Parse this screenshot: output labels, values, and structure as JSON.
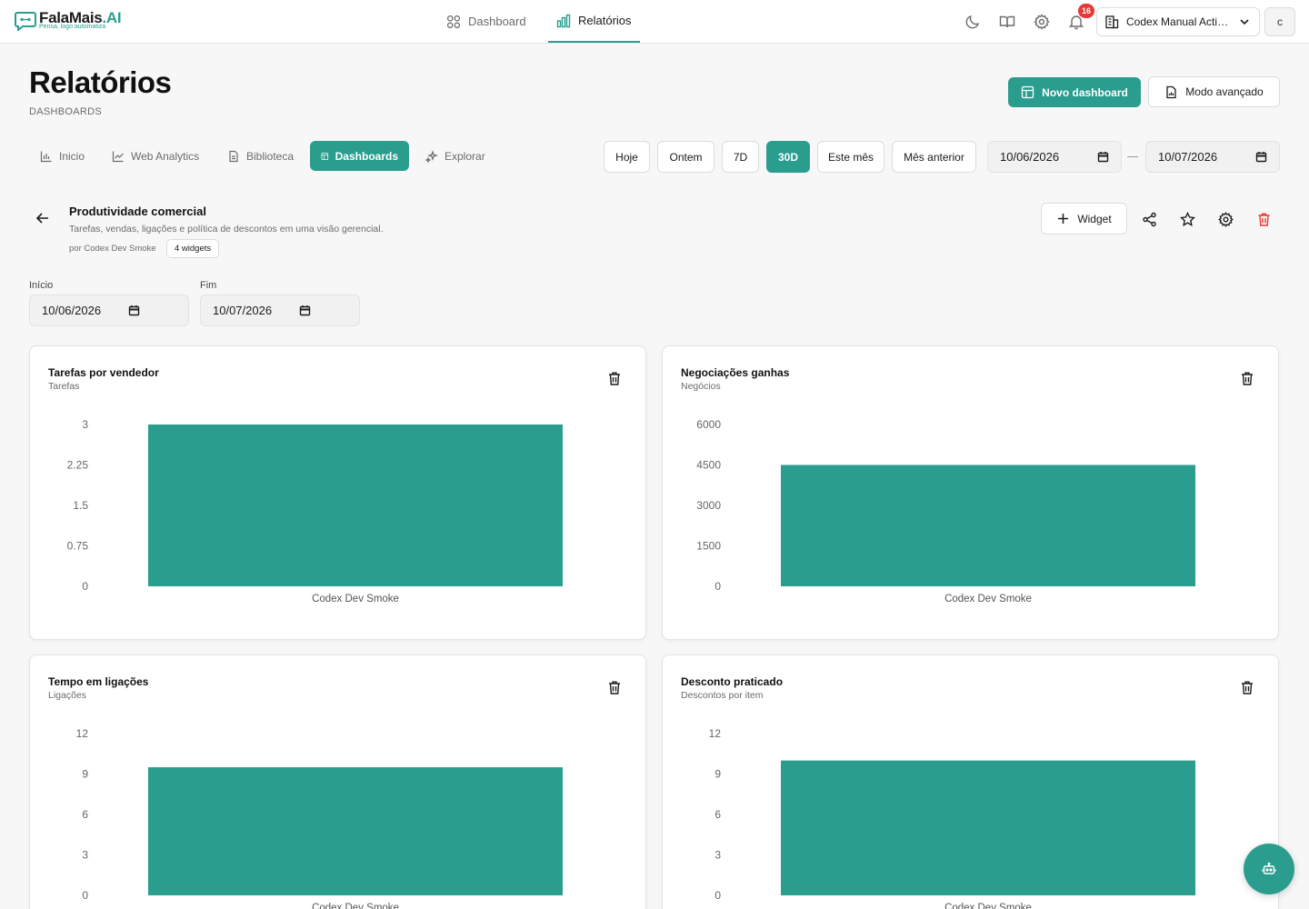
{
  "brand": {
    "name": "FalaMais",
    "name_suffix": ".AI",
    "tagline": "Pensa, logo automatiza"
  },
  "topnav": {
    "dashboard": "Dashboard",
    "relatorios": "Relatórios"
  },
  "notifications": {
    "count": "16"
  },
  "org": {
    "label": "Codex Manual Active..."
  },
  "user": {
    "initial": "c"
  },
  "page": {
    "title": "Relatórios",
    "subtitle": "DASHBOARDS"
  },
  "actions": {
    "new_dashboard": "Novo dashboard",
    "advanced_mode": "Modo avançado"
  },
  "tabs": [
    "Inicio",
    "Web Analytics",
    "Biblioteca",
    "Dashboards",
    "Explorar"
  ],
  "active_tab": "Dashboards",
  "range": {
    "options": [
      "Hoje",
      "Ontem",
      "7D",
      "30D",
      "Este mês",
      "Mês anterior"
    ],
    "active": "30D",
    "start": "10/06/2026",
    "end": "10/07/2026"
  },
  "dashboard": {
    "name": "Produtividade comercial",
    "description": "Tarefas, vendas, ligações e política de descontos em uma visão gerencial.",
    "author": "por Codex Dev Smoke",
    "widget_count": "4 widgets",
    "add_widget": "Widget"
  },
  "filters": {
    "start_label": "Início",
    "start_value": "10/06/2026",
    "end_label": "Fim",
    "end_value": "10/07/2026"
  },
  "colors": {
    "accent": "#2a9d8f",
    "danger": "#e53935"
  },
  "widgets": [
    {
      "title": "Tarefas por vendedor",
      "subtitle": "Tarefas"
    },
    {
      "title": "Negociações ganhas",
      "subtitle": "Negócios"
    },
    {
      "title": "Tempo em ligações",
      "subtitle": "Ligações"
    },
    {
      "title": "Desconto praticado",
      "subtitle": "Descontos por item"
    }
  ],
  "chart_data": [
    {
      "type": "bar",
      "title": "Tarefas por vendedor",
      "categories": [
        "Codex Dev Smoke"
      ],
      "values": [
        3
      ],
      "ylim": [
        0,
        3
      ],
      "yticks": [
        "0",
        "0.75",
        "1.5",
        "2.25",
        "3"
      ],
      "color": "#2a9d8f"
    },
    {
      "type": "bar",
      "title": "Negociações ganhas",
      "categories": [
        "Codex Dev Smoke"
      ],
      "values": [
        4500
      ],
      "ylim": [
        0,
        6000
      ],
      "yticks": [
        "0",
        "1500",
        "3000",
        "4500",
        "6000"
      ],
      "color": "#2a9d8f"
    },
    {
      "type": "bar",
      "title": "Tempo em ligações",
      "categories": [
        "Codex Dev Smoke"
      ],
      "values": [
        9.5
      ],
      "ylim": [
        0,
        12
      ],
      "yticks": [
        "0",
        "3",
        "6",
        "9",
        "12"
      ],
      "color": "#2a9d8f"
    },
    {
      "type": "bar",
      "title": "Desconto praticado",
      "categories": [
        "Codex Dev Smoke"
      ],
      "values": [
        10
      ],
      "ylim": [
        0,
        12
      ],
      "yticks": [
        "0",
        "3",
        "6",
        "9",
        "12"
      ],
      "color": "#2a9d8f"
    }
  ]
}
